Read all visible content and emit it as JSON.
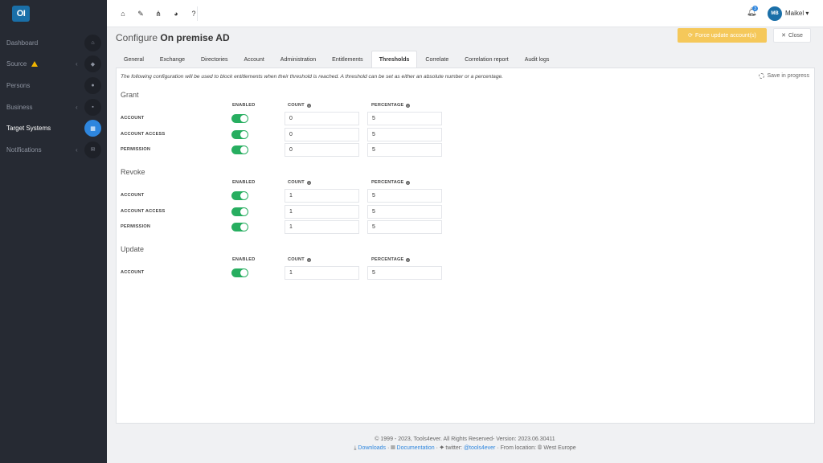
{
  "app": {
    "logo_text": "OI"
  },
  "sidebar": {
    "items": [
      {
        "label": "Dashboard",
        "icon": "home-icon",
        "glyph": "⌂"
      },
      {
        "label": "Source",
        "icon": "database-icon",
        "glyph": "◆",
        "warning": true,
        "chevron": "‹"
      },
      {
        "label": "Persons",
        "icon": "users-icon",
        "glyph": "●"
      },
      {
        "label": "Business",
        "icon": "briefcase-icon",
        "glyph": "▪",
        "chevron": "‹"
      },
      {
        "label": "Target Systems",
        "icon": "grid-icon",
        "glyph": "▦",
        "active": true
      },
      {
        "label": "Notifications",
        "icon": "envelope-icon",
        "glyph": "✉",
        "chevron": "‹"
      }
    ]
  },
  "topbar": {
    "icons": [
      {
        "name": "home-icon",
        "glyph": "⌂"
      },
      {
        "name": "wrench-icon",
        "glyph": "✎"
      },
      {
        "name": "sitemap-icon",
        "glyph": "⋔"
      },
      {
        "name": "pie-chart-icon",
        "glyph": "◕"
      },
      {
        "name": "help-icon",
        "glyph": "?"
      }
    ],
    "notifications_count": "3",
    "avatar_initials": "MB",
    "user_name": "Maikel ▾"
  },
  "header": {
    "prefix": "Configure ",
    "title": "On premise AD",
    "force_update_label": "Force update account(s)",
    "close_label": "Close"
  },
  "tabs": [
    {
      "label": "General"
    },
    {
      "label": "Exchange"
    },
    {
      "label": "Directories"
    },
    {
      "label": "Account"
    },
    {
      "label": "Administration"
    },
    {
      "label": "Entitlements"
    },
    {
      "label": "Thresholds",
      "active": true
    },
    {
      "label": "Correlate"
    },
    {
      "label": "Correlation report"
    },
    {
      "label": "Audit logs"
    }
  ],
  "panel": {
    "info_text": "The following configuration will be used to block entitlements when their threshold is reached. A threshold can be set as either an absolute number or a percentage.",
    "save_status": "Save in progress",
    "columns": {
      "enabled": "ENABLED",
      "count": "COUNT",
      "percentage": "PERCENTAGE"
    },
    "sections": [
      {
        "title": "Grant",
        "rows": [
          {
            "label": "ACCOUNT",
            "enabled": true,
            "count": "0",
            "percentage": "5"
          },
          {
            "label": "ACCOUNT ACCESS",
            "enabled": true,
            "count": "0",
            "percentage": "5"
          },
          {
            "label": "PERMISSION",
            "enabled": true,
            "count": "0",
            "percentage": "5"
          }
        ]
      },
      {
        "title": "Revoke",
        "rows": [
          {
            "label": "ACCOUNT",
            "enabled": true,
            "count": "1",
            "percentage": "5"
          },
          {
            "label": "ACCOUNT ACCESS",
            "enabled": true,
            "count": "1",
            "percentage": "5"
          },
          {
            "label": "PERMISSION",
            "enabled": true,
            "count": "1",
            "percentage": "5"
          }
        ]
      },
      {
        "title": "Update",
        "rows": [
          {
            "label": "ACCOUNT",
            "enabled": true,
            "count": "1",
            "percentage": "5"
          }
        ]
      }
    ]
  },
  "footer": {
    "copyright": "© 1999 - 2023, Tools4ever. All Rights Reserved- Version: 2023.06.30411",
    "downloads": "Downloads",
    "documentation": "Documentation",
    "twitter_prefix": "twitter: ",
    "twitter_handle": "@tools4ever",
    "location": " · From location: ",
    "region": "West Europe"
  }
}
